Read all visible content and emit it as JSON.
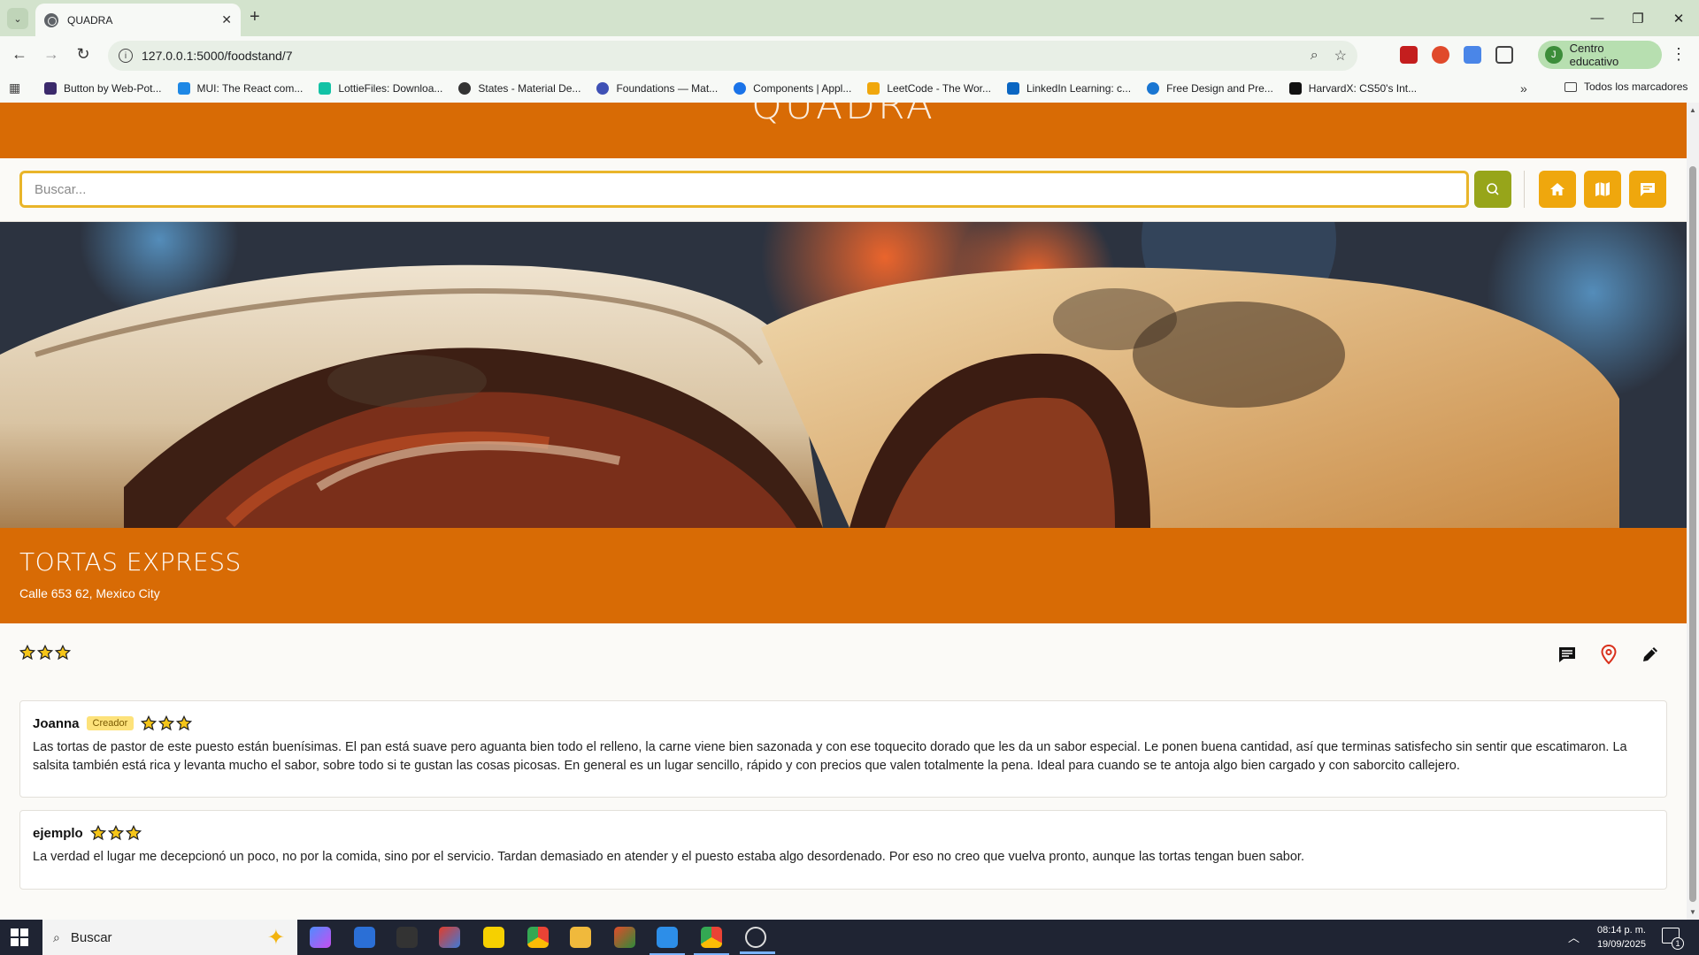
{
  "browser": {
    "tab_title": "QUADRA",
    "url": "127.0.0.1:5000/foodstand/7",
    "profile_label": "Centro educativo",
    "profile_initial": "J",
    "bookmarks": [
      {
        "label": "Button by Web-Pot...",
        "color": "#3b2a6b"
      },
      {
        "label": "MUI: The React com...",
        "color": "#1e88e5"
      },
      {
        "label": "LottieFiles: Downloa...",
        "color": "#12c2a5"
      },
      {
        "label": "States - Material De...",
        "color": "#333333"
      },
      {
        "label": "Foundations — Mat...",
        "color": "#3f51b5"
      },
      {
        "label": "Components | Appl...",
        "color": "#1a73e8"
      },
      {
        "label": "LeetCode - The Wor...",
        "color": "#f0a70c"
      },
      {
        "label": "LinkedIn Learning: c...",
        "color": "#0a66c2"
      },
      {
        "label": "Free Design and Pre...",
        "color": "#1976d2"
      },
      {
        "label": "HarvardX: CS50's Int...",
        "color": "#111111"
      }
    ],
    "all_bookmarks_label": "Todos los marcadores"
  },
  "site": {
    "brand": "QUADRA",
    "search_placeholder": "Buscar...",
    "colors": {
      "primary": "#d86b05",
      "accent": "#efa70d",
      "search_button": "#97a51a",
      "input_border": "#e9b52a"
    },
    "nav_icons": [
      "home-icon",
      "map-icon",
      "message-icon"
    ]
  },
  "stand": {
    "name": "TORTAS EXPRESS",
    "address": "Calle 653 62, Mexico City",
    "rating": 3,
    "action_icons": [
      "comment-icon",
      "location-pin-icon",
      "edit-pencil-icon"
    ]
  },
  "reviews": [
    {
      "author": "Joanna",
      "badge": "Creador",
      "rating": 3,
      "text": "Las tortas de pastor de este puesto están buenísimas. El pan está suave pero aguanta bien todo el relleno, la carne viene bien sazonada y con ese toquecito dorado que les da un sabor especial. Le ponen buena cantidad, así que terminas satisfecho sin sentir que escatimaron. La salsita también está rica y levanta mucho el sabor, sobre todo si te gustan las cosas picosas. En general es un lugar sencillo, rápido y con precios que valen totalmente la pena. Ideal para cuando se te antoja algo bien cargado y con saborcito callejero."
    },
    {
      "author": "ejemplo",
      "badge": "",
      "rating": 3,
      "text": "La verdad el lugar me decepcionó un poco, no por la comida, sino por el servicio. Tardan demasiado en atender y el puesto estaba algo desordenado. Por eso no creo que vuelva pronto, aunque las tortas tengan buen sabor."
    }
  ],
  "taskbar": {
    "search_label": "Buscar",
    "time": "08:14 p. m.",
    "date": "19/09/2025",
    "notification_count": "1"
  }
}
